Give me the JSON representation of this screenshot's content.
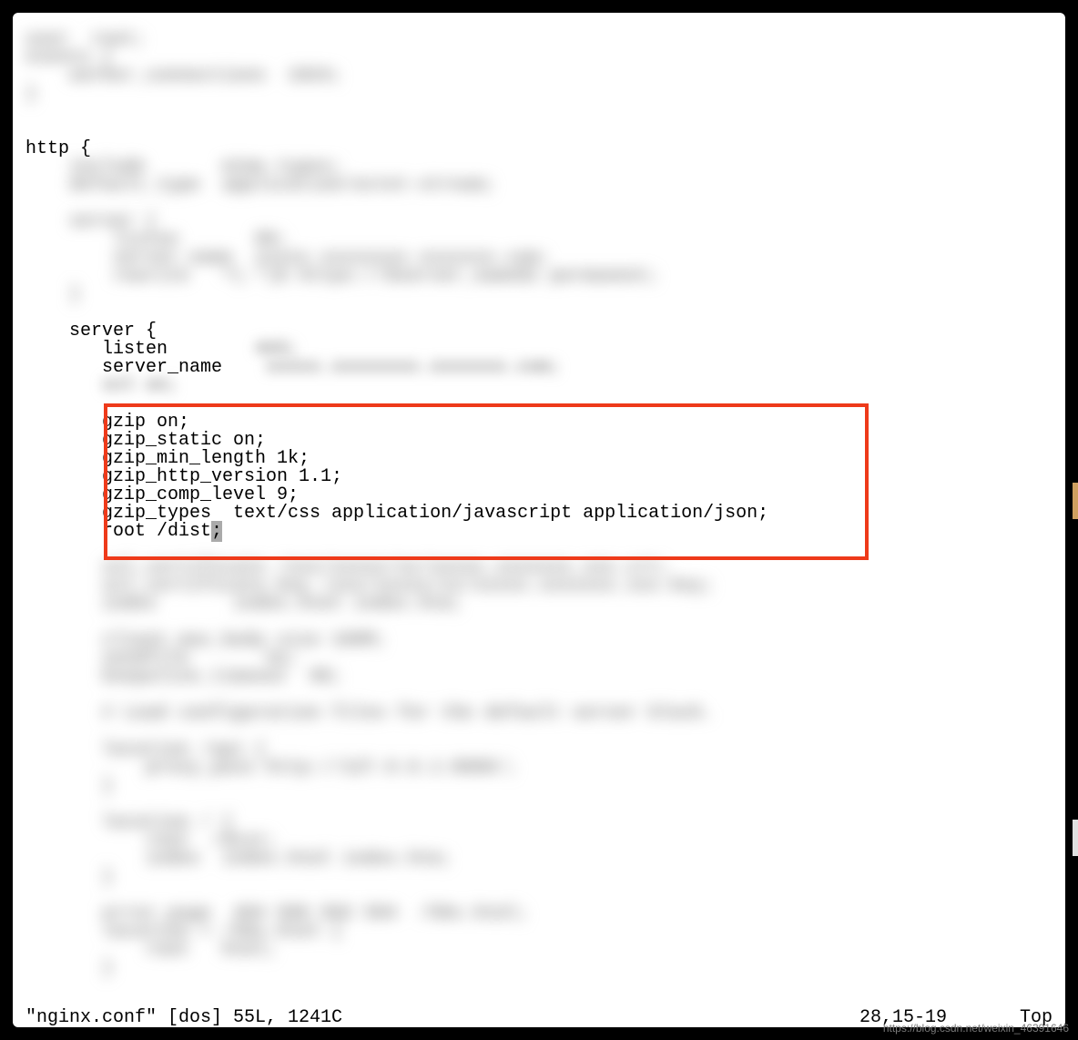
{
  "code": {
    "top_blur": "user  root;\nevents {\n    worker_connections  1024;\n}",
    "http_open": "http {",
    "http_blur1": "    include       mime.types;\n    default_type  application/octet-stream;",
    "http_blur2": "    server {\n        listen       80;\n        server_name  xxxxx.xxxxxxxx.xxxxxxx.com;\n        rewrite   ^(.*)$ https://$server_name$1 permanent;\n    }",
    "server_open": "    server {",
    "listen_label": "       listen",
    "listen_blur": "        443;",
    "sname_label": "       server_name",
    "sname_blur": "    xxxxx.xxxxxxxx.xxxxxxx.com;",
    "ssl_blur": "       ssl on;",
    "gzip_on": "       gzip on;",
    "gzip_static": "       gzip_static on;",
    "gzip_min": "       gzip_min_length 1k;",
    "gzip_ver": "       gzip_http_version 1.1;",
    "gzip_comp": "       gzip_comp_level 9;",
    "gzip_types": "       gzip_types  text/css application/javascript application/json;",
    "root_pre": "       root /dist",
    "root_cursor": ";",
    "bottom_blur": "       ssl_certificate /xxx/xxxxx/xx/xxxxx.xxxxxxx.xxx.crt;\n       ssl_certificate_key /xxx/xxxxx/xx/xxxxx.xxxxxxx.xxx.key;\n       index       index.html index.htm;\n\n       client_max_body_size 100M;\n       sendfile       on;\n       keepalive_timeout  90;\n\n       # Load configuration files for the default server block.\n\n       location /api {\n           proxy_pass http://127.0.0.1:8080/;\n       }\n\n       location / {\n           root  /dist;\n           index  index.html index.htm;\n       }\n\n       error_page  404 500 502 504  /50x.html;\n       location = /50x.html {\n           root   html;\n       }"
  },
  "status": {
    "left": "\"nginx.conf\" [dos] 55L, 1241C",
    "mid": "28,15-19",
    "right": "Top"
  },
  "watermark": "https://blog.csdn.net/weixin_46391646"
}
